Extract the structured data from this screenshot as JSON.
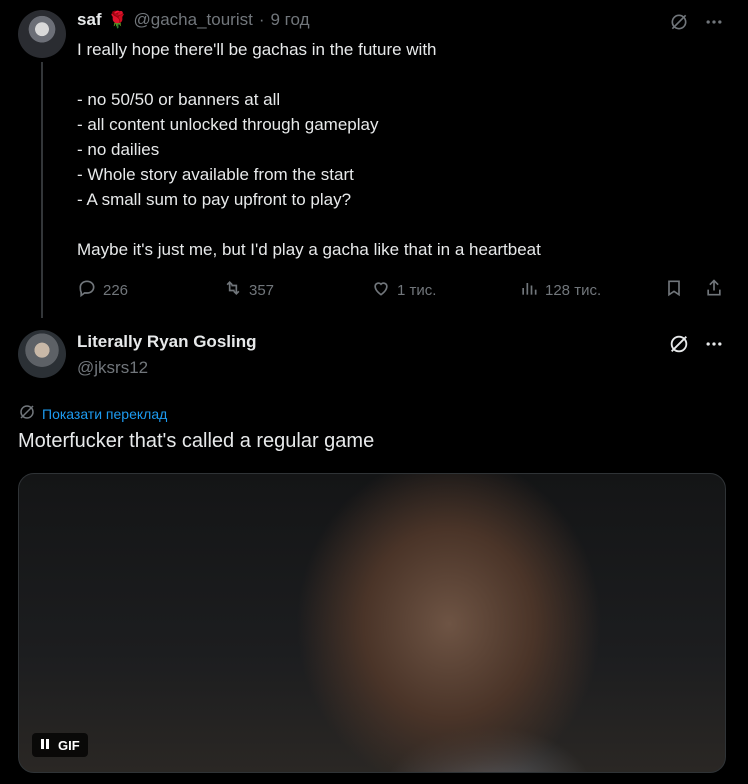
{
  "tweet": {
    "display_name": "saf",
    "name_emoji": "🌹",
    "handle": "@gacha_tourist",
    "separator": "·",
    "time": "9 год",
    "text": "I really hope there'll be gachas in the future with\n\n- no 50/50 or banners at all\n- all content unlocked through gameplay\n- no dailies\n- Whole story available from the start\n- A small sum to pay upfront to play?\n\nMaybe it's just me, but I'd play a gacha like that in a heartbeat",
    "actions": {
      "replies": "226",
      "reposts": "357",
      "likes": "1 тис.",
      "views": "128 тис."
    }
  },
  "reply": {
    "display_name": "Literally Ryan Gosling",
    "handle": "@jksrs12",
    "translate_label": "Показати переклад",
    "text": "Moterfucker that's called a regular game",
    "media_badge": "GIF"
  },
  "icons": {
    "grok": "grok-icon",
    "more": "more-icon",
    "reply": "reply-icon",
    "repost": "repost-icon",
    "like": "like-icon",
    "views": "views-icon",
    "bookmark": "bookmark-icon",
    "share": "share-icon",
    "translate": "translate-icon",
    "pause": "pause-icon"
  },
  "colors": {
    "background": "#000000",
    "text": "#e7e9ea",
    "muted": "#71767b",
    "link": "#1d9bf0",
    "rose": "#d9000d"
  }
}
